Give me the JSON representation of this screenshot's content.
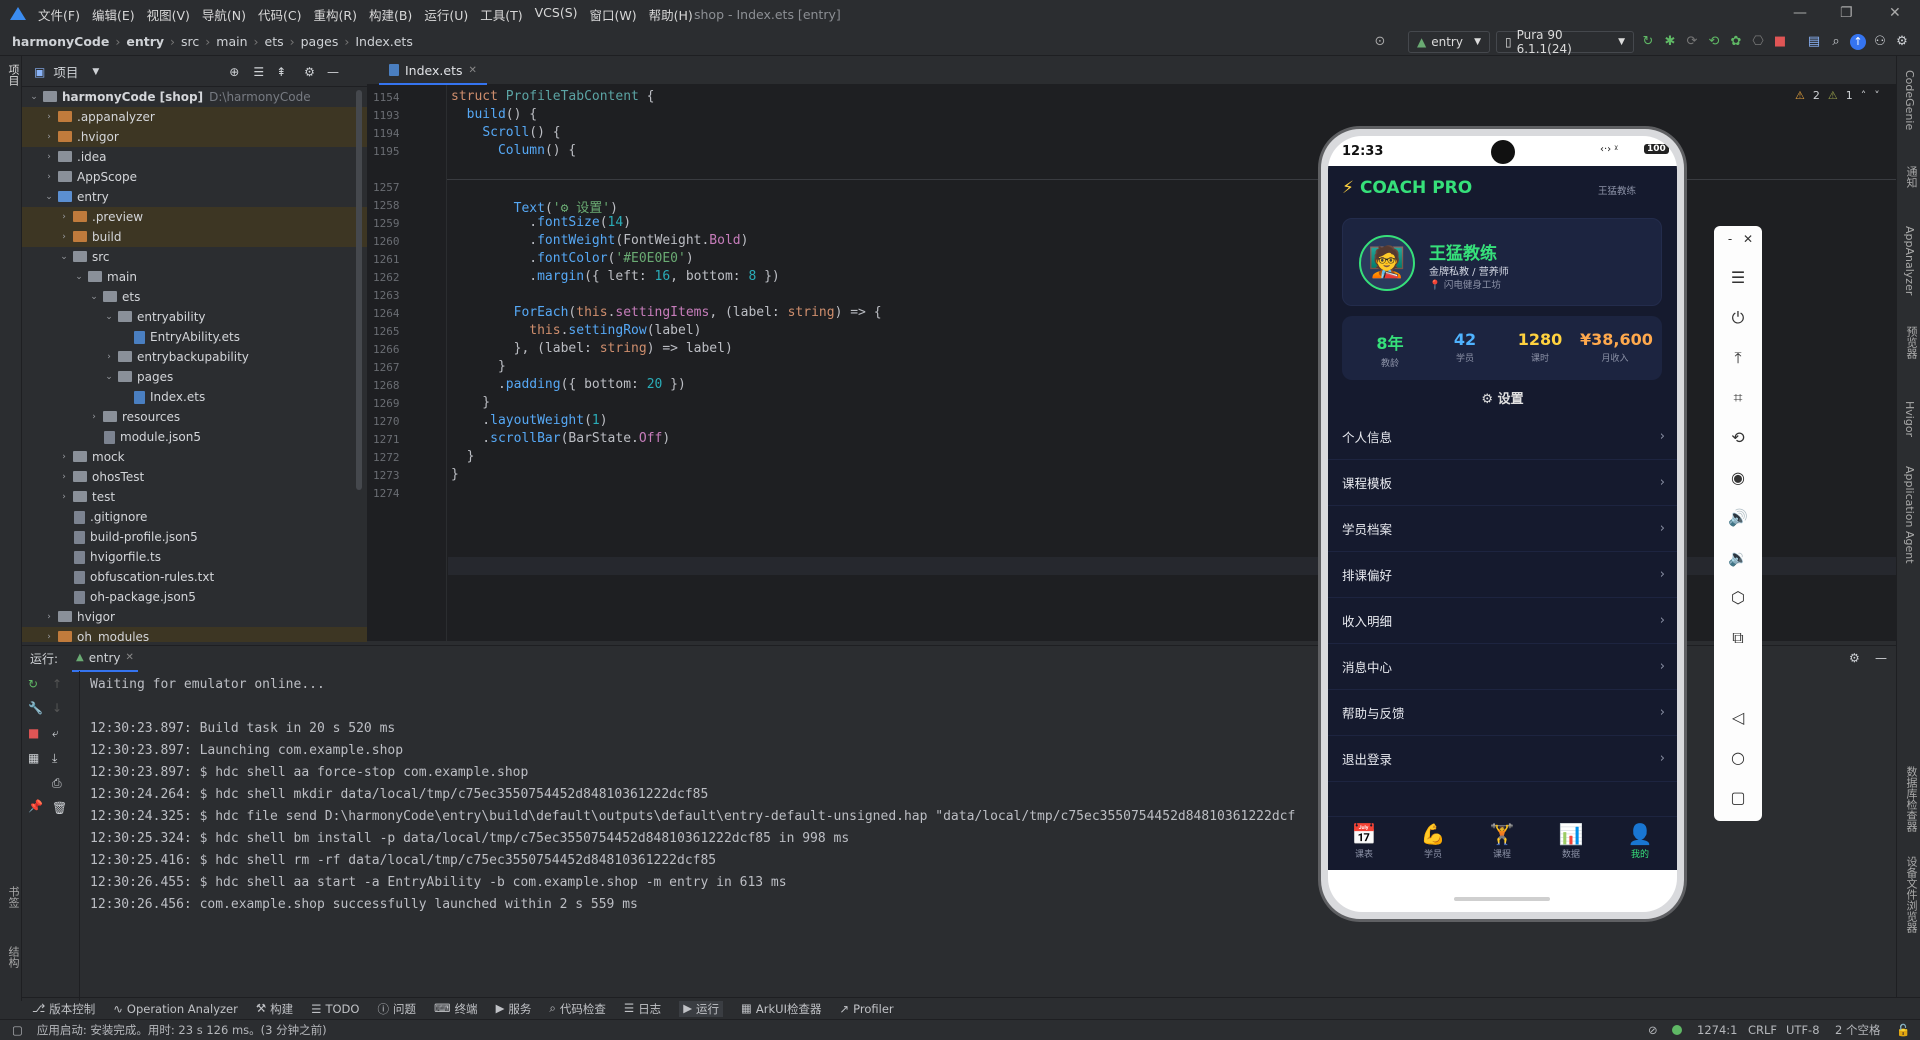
{
  "menubar": {
    "items": [
      "文件(F)",
      "编辑(E)",
      "视图(V)",
      "导航(N)",
      "代码(C)",
      "重构(R)",
      "构建(B)",
      "运行(U)",
      "工具(T)",
      "VCS(S)",
      "窗口(W)",
      "帮助(H)"
    ],
    "window_title": "shop - Index.ets [entry]"
  },
  "breadcrumb": [
    "harmonyCode",
    "entry",
    "src",
    "main",
    "ets",
    "pages",
    "Index.ets"
  ],
  "toolbar": {
    "module": "entry",
    "device": "Pura 90 6.1.1(24)"
  },
  "project": {
    "title": "项目",
    "root_name": "harmonyCode [shop]",
    "root_path": "D:\\harmonyCode",
    "items": [
      {
        "label": ".appanalyzer",
        "depth": 1,
        "type": "folder-or",
        "arrow": "›",
        "hl": true
      },
      {
        "label": ".hvigor",
        "depth": 1,
        "type": "folder-or",
        "arrow": "›",
        "hl": true
      },
      {
        "label": ".idea",
        "depth": 1,
        "type": "folder",
        "arrow": "›",
        "hl": false
      },
      {
        "label": "AppScope",
        "depth": 1,
        "type": "folder",
        "arrow": "›",
        "hl": false
      },
      {
        "label": "entry",
        "depth": 1,
        "type": "folder-bl",
        "arrow": "⌄",
        "hl": false
      },
      {
        "label": ".preview",
        "depth": 2,
        "type": "folder-or",
        "arrow": "›",
        "hl": true
      },
      {
        "label": "build",
        "depth": 2,
        "type": "folder-or",
        "arrow": "›",
        "hl": true
      },
      {
        "label": "src",
        "depth": 2,
        "type": "folder",
        "arrow": "⌄",
        "hl": false
      },
      {
        "label": "main",
        "depth": 3,
        "type": "folder",
        "arrow": "⌄",
        "hl": false
      },
      {
        "label": "ets",
        "depth": 4,
        "type": "folder",
        "arrow": "⌄",
        "hl": false
      },
      {
        "label": "entryability",
        "depth": 5,
        "type": "folder",
        "arrow": "⌄",
        "hl": false
      },
      {
        "label": "EntryAbility.ets",
        "depth": 6,
        "type": "ets",
        "arrow": "",
        "hl": false
      },
      {
        "label": "entrybackupability",
        "depth": 5,
        "type": "folder",
        "arrow": "›",
        "hl": false
      },
      {
        "label": "pages",
        "depth": 5,
        "type": "folder",
        "arrow": "⌄",
        "hl": false
      },
      {
        "label": "Index.ets",
        "depth": 6,
        "type": "ets",
        "arrow": "",
        "hl": false
      },
      {
        "label": "resources",
        "depth": 4,
        "type": "folder",
        "arrow": "›",
        "hl": false
      },
      {
        "label": "module.json5",
        "depth": 4,
        "type": "file",
        "arrow": "",
        "hl": false
      },
      {
        "label": "mock",
        "depth": 2,
        "type": "folder",
        "arrow": "›",
        "hl": false
      },
      {
        "label": "ohosTest",
        "depth": 2,
        "type": "folder",
        "arrow": "›",
        "hl": false
      },
      {
        "label": "test",
        "depth": 2,
        "type": "folder",
        "arrow": "›",
        "hl": false
      },
      {
        "label": ".gitignore",
        "depth": 2,
        "type": "file",
        "arrow": "",
        "hl": false
      },
      {
        "label": "build-profile.json5",
        "depth": 2,
        "type": "file",
        "arrow": "",
        "hl": false
      },
      {
        "label": "hvigorfile.ts",
        "depth": 2,
        "type": "file",
        "arrow": "",
        "hl": false
      },
      {
        "label": "obfuscation-rules.txt",
        "depth": 2,
        "type": "file",
        "arrow": "",
        "hl": false
      },
      {
        "label": "oh-package.json5",
        "depth": 2,
        "type": "file",
        "arrow": "",
        "hl": false
      },
      {
        "label": "hvigor",
        "depth": 1,
        "type": "folder",
        "arrow": "›",
        "hl": false
      },
      {
        "label": "oh_modules",
        "depth": 1,
        "type": "folder-or",
        "arrow": "›",
        "hl": true
      }
    ]
  },
  "editor": {
    "tab": "Index.ets",
    "warnings": "2",
    "weak_warnings": "1",
    "lines": [
      {
        "n": "1154",
        "html": "<span class='kw'>struct</span> <span class='ty'>ProfileTabContent</span> {"
      },
      {
        "n": "1193",
        "html": "  <span class='fn'>build</span>() {"
      },
      {
        "n": "1194",
        "html": "    <span class='fn'>Scroll</span>() {"
      },
      {
        "n": "1195",
        "html": "      <span class='fn'>Column</span>() {"
      },
      {
        "n": "1257",
        "html": ""
      },
      {
        "n": "1258",
        "html": "        <span class='fn'>Text</span>(<span class='str'>'⚙ 设置'</span>)"
      },
      {
        "n": "1259",
        "html": "          .<span class='fn'>fontSize</span>(<span class='num'>14</span>)"
      },
      {
        "n": "1260",
        "html": "          .<span class='fn'>fontWeight</span>(FontWeight.<span class='pr'>Bold</span>)"
      },
      {
        "n": "1261",
        "html": "          .<span class='fn'>fontColor</span>(<span class='str'>'#E0E0E0'</span>)"
      },
      {
        "n": "1262",
        "html": "          .<span class='fn'>margin</span>({ left: <span class='num'>16</span>, bottom: <span class='num'>8</span> })"
      },
      {
        "n": "1263",
        "html": ""
      },
      {
        "n": "1264",
        "html": "        <span class='fn'>ForEach</span>(<span class='kw'>this</span>.<span class='pr'>settingItems</span>, (label: <span class='kw'>string</span>) => {"
      },
      {
        "n": "1265",
        "html": "          <span class='kw'>this</span>.<span class='fn'>settingRow</span>(label)"
      },
      {
        "n": "1266",
        "html": "        }, (label: <span class='kw'>string</span>) => label)"
      },
      {
        "n": "1267",
        "html": "      }"
      },
      {
        "n": "1268",
        "html": "      .<span class='fn'>padding</span>({ bottom: <span class='num'>20</span> })"
      },
      {
        "n": "1269",
        "html": "    }"
      },
      {
        "n": "1270",
        "html": "    .<span class='fn'>layoutWeight</span>(<span class='num'>1</span>)"
      },
      {
        "n": "1271",
        "html": "    .<span class='fn'>scrollBar</span>(BarState.<span class='pr'>Off</span>)"
      },
      {
        "n": "1272",
        "html": "  }"
      },
      {
        "n": "1273",
        "html": "}"
      },
      {
        "n": "1274",
        "html": ""
      }
    ]
  },
  "run": {
    "label": "运行:",
    "tab": "entry",
    "console": [
      "Waiting for emulator online...",
      "",
      "12:30:23.897: Build task in 20 s 520 ms",
      "12:30:23.897: Launching com.example.shop",
      "12:30:23.897: $ hdc shell aa force-stop com.example.shop",
      "12:30:24.264: $ hdc shell mkdir data/local/tmp/c75ec3550754452d84810361222dcf85",
      "12:30:24.325: $ hdc file send D:\\harmonyCode\\entry\\build\\default\\outputs\\default\\entry-default-unsigned.hap \"data/local/tmp/c75ec3550754452d84810361222dcf",
      "12:30:25.324: $ hdc shell bm install -p data/local/tmp/c75ec3550754452d84810361222dcf85 in 998 ms",
      "12:30:25.416: $ hdc shell rm -rf data/local/tmp/c75ec3550754452d84810361222dcf85",
      "12:30:26.455: $ hdc shell aa start -a EntryAbility -b com.example.shop -m entry in 613 ms",
      "12:30:26.456: com.example.shop successfully launched within 2 s 559 ms"
    ]
  },
  "bottom_tools": [
    "版本控制",
    "Operation Analyzer",
    "构建",
    "TODO",
    "问题",
    "终端",
    "服务",
    "代码检查",
    "日志",
    "运行",
    "ArkUI检查器",
    "Profiler"
  ],
  "status": {
    "message": "应用启动: 安装完成。用时: 23 s 126 ms。(3 分钟之前)",
    "position": "1274:1",
    "line_sep": "CRLF",
    "encoding": "UTF-8",
    "indent": "2 个空格"
  },
  "left_strip": {
    "project": "项目",
    "bookmarks": "书签",
    "structure": "结构"
  },
  "right_strip": [
    "CodeGenie",
    "通知",
    "AppAnalyzer",
    "预览器",
    "Hvigor",
    "Application Agent",
    "数据库检查器",
    "设备文件浏览器"
  ],
  "phone": {
    "time": "12:33",
    "status_icons": "‹·› ᵡ",
    "battery": "100",
    "app_title": "COACH PRO",
    "header_user": "王猛教练",
    "profile_name": "王猛教练",
    "profile_role": "金牌私教 / 营养师",
    "profile_gym": "📍 闪电健身工坊",
    "stats": [
      {
        "value": "8年",
        "label": "教龄",
        "color": "#36e07a"
      },
      {
        "value": "42",
        "label": "学员",
        "color": "#4fb3ff"
      },
      {
        "value": "1280",
        "label": "课时",
        "color": "#ffd23f"
      },
      {
        "value": "¥38,600",
        "label": "月收入",
        "color": "#ffa94d"
      }
    ],
    "settings_title": "⚙ 设置",
    "menu": [
      "个人信息",
      "课程模板",
      "学员档案",
      "排课偏好",
      "收入明细",
      "消息中心",
      "帮助与反馈",
      "退出登录"
    ],
    "nav": [
      {
        "icon": "📅",
        "label": "课表",
        "active": false
      },
      {
        "icon": "💪",
        "label": "学员",
        "active": false
      },
      {
        "icon": "🏋",
        "label": "课程",
        "active": false
      },
      {
        "icon": "📊",
        "label": "数据",
        "active": false
      },
      {
        "icon": "👤",
        "label": "我的",
        "active": true
      }
    ],
    "accent": "#36e07a"
  }
}
